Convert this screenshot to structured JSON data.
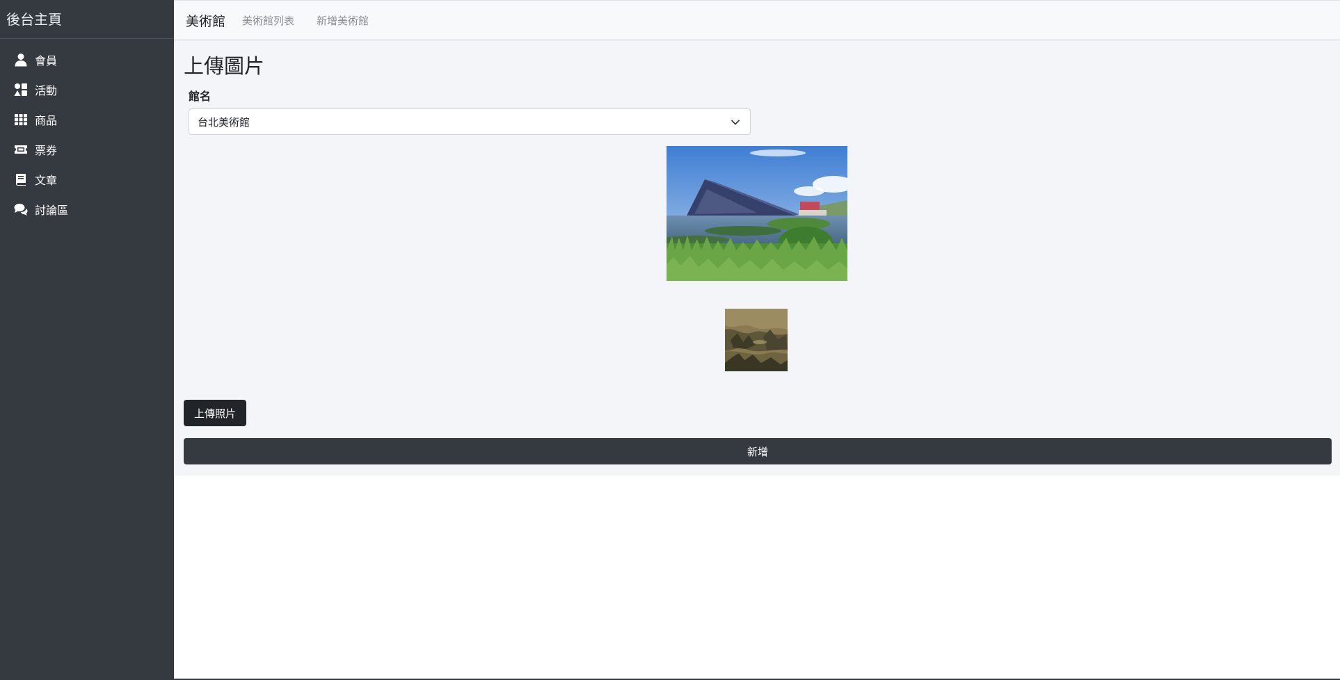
{
  "sidebar": {
    "brand": "後台主頁",
    "items": [
      {
        "label": "會員",
        "icon": "user-icon"
      },
      {
        "label": "活動",
        "icon": "shapes-icon"
      },
      {
        "label": "商品",
        "icon": "grid-icon"
      },
      {
        "label": "票券",
        "icon": "ticket-icon"
      },
      {
        "label": "文章",
        "icon": "book-icon"
      },
      {
        "label": "討論區",
        "icon": "comments-icon"
      }
    ]
  },
  "topnav": {
    "brand": "美術館",
    "links": [
      "美術館列表",
      "新增美術館"
    ]
  },
  "main": {
    "title": "上傳圖片",
    "field_label": "館名",
    "select_value": "台北美術館",
    "upload_button": "上傳照片",
    "submit_button": "新增"
  },
  "colors": {
    "sidebar_bg": "#343a40",
    "topnav_bg": "#f8f9fa",
    "main_bg": "#f4f5f8",
    "button_dark": "#212529",
    "submit_bg": "#343a40"
  }
}
